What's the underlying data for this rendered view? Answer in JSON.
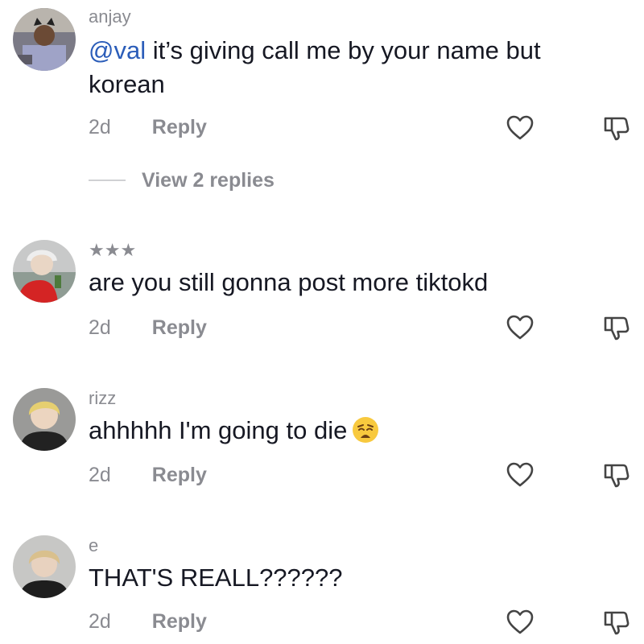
{
  "comments": [
    {
      "username": "anjay",
      "mention": "@val",
      "text": " it’s giving call me by your name but korean",
      "time": "2d",
      "reply_label": "Reply",
      "view_replies": "View 2 replies"
    },
    {
      "username": "★★★",
      "text": "are you still gonna post more tiktokd",
      "time": "2d",
      "reply_label": "Reply"
    },
    {
      "username": "rizz",
      "text": "ahhhhh I'm going to die",
      "emoji": "weary-face-emoji",
      "time": "2d",
      "reply_label": "Reply"
    },
    {
      "username": "e",
      "text": "THAT'S REALL??????",
      "time": "2d",
      "reply_label": "Reply"
    }
  ],
  "icons": {
    "like": "heart-outline-icon",
    "dislike": "thumbs-down-outline-icon"
  },
  "colors": {
    "mention": "#2b5db9",
    "secondary_text": "#8a8b91",
    "primary_text": "#161823"
  }
}
